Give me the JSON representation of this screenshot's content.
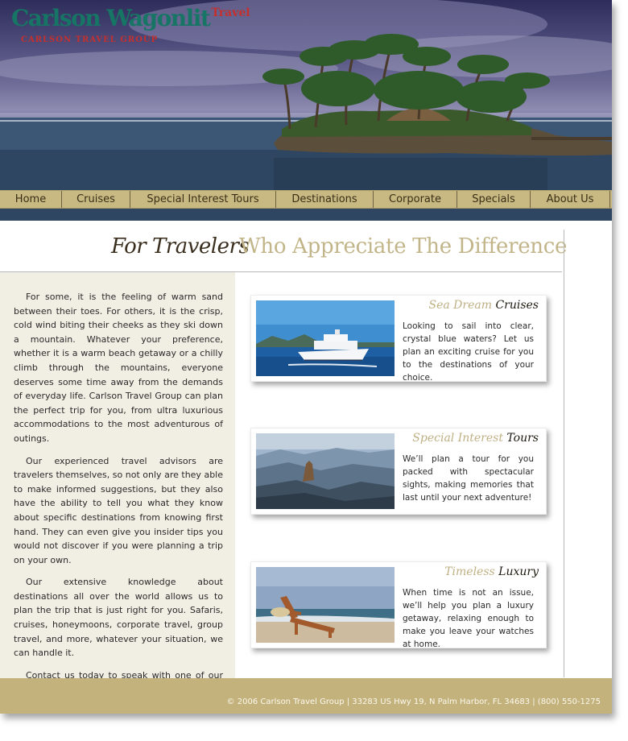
{
  "logo": {
    "main": "Carlson Wagonlit",
    "travel": "Travel",
    "sub": "CARLSON TRAVEL GROUP"
  },
  "nav": {
    "items": [
      {
        "label": "Home"
      },
      {
        "label": "Cruises"
      },
      {
        "label": "Special Interest Tours"
      },
      {
        "label": "Destinations"
      },
      {
        "label": "Corporate"
      },
      {
        "label": "Specials"
      },
      {
        "label": "About Us"
      }
    ]
  },
  "title": {
    "dark": "For Travelers",
    "light": "Who Appreciate The Difference"
  },
  "intro": {
    "p1": "For some, it is the feeling of warm sand between their toes. For others, it is the crisp, cold wind biting their cheeks as they ski down a mountain. Whatever your preference, whether it is a warm beach getaway or a chilly climb through the mountains, everyone deserves some time away from the demands of everyday life. Carlson Travel Group can plan the perfect trip for you, from ultra luxurious accommodations to the most adventurous of outings.",
    "p2": "Our experienced travel advisors are travelers themselves, so not only are they able to make informed suggestions, but they also have the ability to tell you what they know about specific destinations from knowing first hand. They can even give you insider tips you would not discover if you were planning a trip on your own.",
    "p3": "Our extensive knowledge about destinations all over the world allows us to plan the trip that is just right for you. Safaris, cruises, honeymoons, corporate travel, group travel, and more, whatever your situation, we can handle it.",
    "contact_link": "Contact us today",
    "p4_rest": " to speak with one of our travel advisors. We look forward to planning with you!"
  },
  "cards": [
    {
      "title_light": "Sea Dream ",
      "title_dark": "Cruises",
      "body": "Looking to sail into clear, crystal blue waters? Let us plan an exciting cruise for you to the destinations of your choice."
    },
    {
      "title_light": "Special Interest ",
      "title_dark": "Tours",
      "body": "We’ll plan a tour for you packed with spectacular sights, making memories that last until your next adventure!"
    },
    {
      "title_light": "Timeless ",
      "title_dark": "Luxury",
      "body": "When time is not an issue, we’ll help you plan a luxury getaway, relaxing enough to make you leave your watches at home."
    }
  ],
  "footer": {
    "text": "© 2006 Carlson Travel Group  |  33283 US Hwy 19, N Palm Harbor, FL 34683  |  (800) 550-1275"
  },
  "colors": {
    "nav_bg": "#c8b982",
    "footer_bg": "#c3b27b",
    "title_light": "#c2b589",
    "left_panel_bg": "#f1eee4",
    "logo_green": "#167564",
    "logo_red": "#c5302e"
  }
}
